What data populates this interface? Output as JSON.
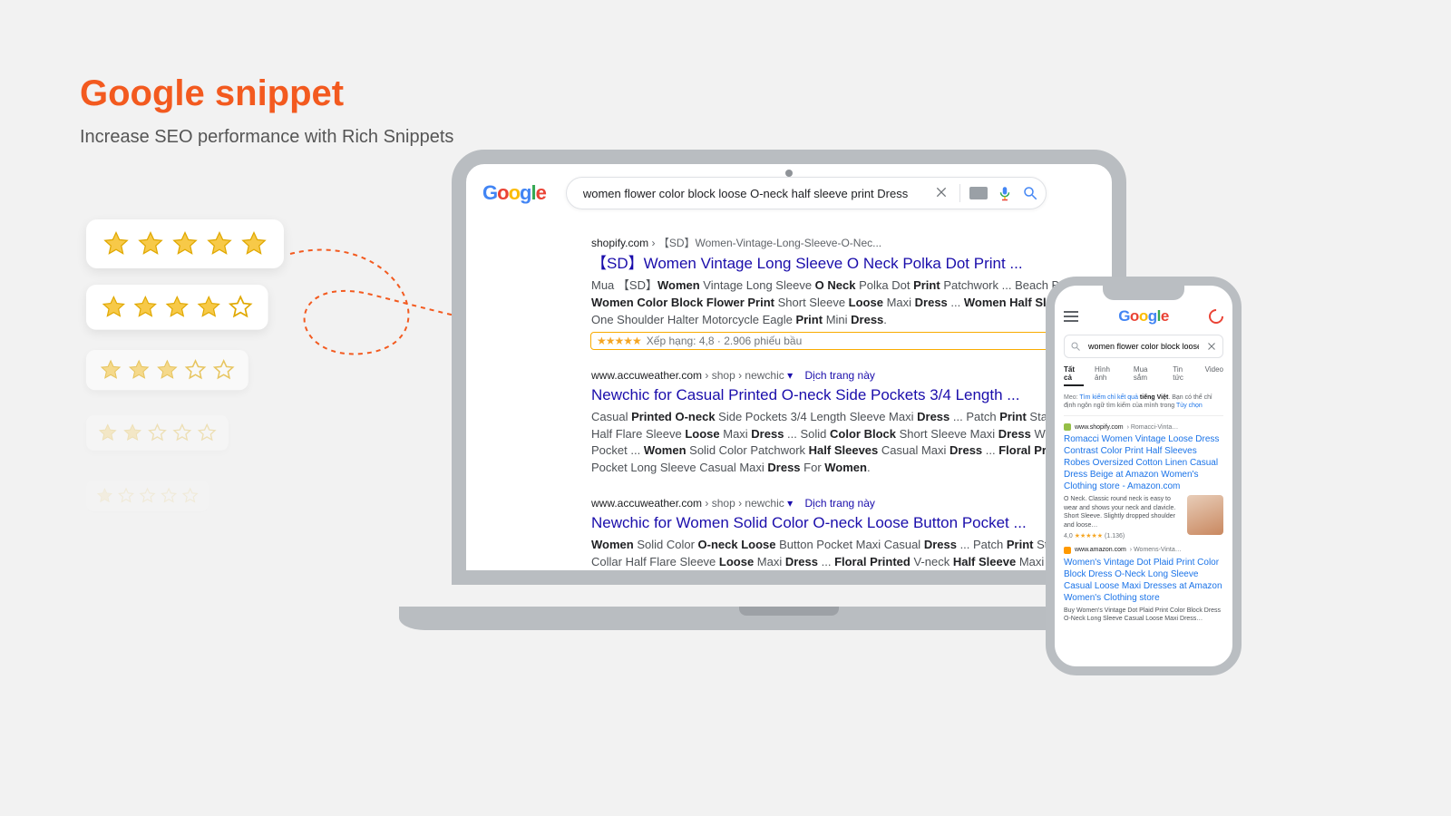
{
  "heading": {
    "title": "Google snippet",
    "subtitle": "Increase SEO performance with Rich Snippets"
  },
  "google_logo_letters": [
    "G",
    "o",
    "o",
    "g",
    "l",
    "e"
  ],
  "laptop": {
    "search_query": "women flower color block loose O-neck half sleeve print Dress",
    "results": [
      {
        "url_domain": "shopify.com",
        "url_path": "› 【SD】Women-Vintage-Long-Sleeve-O-Nec...",
        "title": "【SD】Women Vintage Long Sleeve O Neck Polka Dot Print ...",
        "desc_html": "Mua 【SD】<b>Women</b> Vintage Long Sleeve <b>O Neck</b> Polka Dot <b>Print</b> Patchwork ... Beach Boho <b>Women Color Block Flower Print</b> Short Sleeve <b>Loose</b> Maxi <b>Dress</b> ... <b>Women Half Sleeve</b> One Shoulder Halter Motorcycle Eagle <b>Print</b> Mini <b>Dress</b>.",
        "rating_text": "Xếp hạng: 4,8 · 2.906 phiếu bầu"
      },
      {
        "url_domain": "www.accuweather.com",
        "url_path": "› shop › newchic",
        "translate": "Dịch trang này",
        "title": "Newchic for Casual Printed O-neck Side Pockets 3/4 Length ...",
        "desc_html": "Casual <b>Printed O-neck</b> Side Pockets 3/4 Length Sleeve Maxi <b>Dress</b> ... Patch <b>Print</b> Stand Collar Half Flare Sleeve <b>Loose</b> Maxi <b>Dress</b> ... Solid <b>Color Block</b> Short Sleeve Maxi <b>Dress</b> With Pocket ... <b>Women</b> Solid Color Patchwork <b>Half Sleeves</b> Casual Maxi <b>Dress</b> ... <b>Floral Print</b> Pocket Long Sleeve Casual Maxi <b>Dress</b> For <b>Women</b>."
      },
      {
        "url_domain": "www.accuweather.com",
        "url_path": "› shop › newchic",
        "translate": "Dịch trang này",
        "title": "Newchic for Women Solid Color O-neck Loose Button Pocket ...",
        "desc_html": "<b>Women</b> Solid Color <b>O-neck Loose</b> Button Pocket Maxi Casual <b>Dress</b> ... Patch <b>Print</b> Stand Collar Half Flare Sleeve <b>Loose</b> Maxi <b>Dress</b> ... <b>Floral Printed</b> V-neck <b>Half Sleeve</b> Maxi <b>Dress</b> ... Solid <b>Color Block</b> Short Sleeve Maxi <b>Dress</b> With Pocket."
      }
    ]
  },
  "phone": {
    "search_query": "women flower color block loose O-",
    "tabs": [
      "Tất cả",
      "Hình ảnh",
      "Mua sắm",
      "Tin tức",
      "Video"
    ],
    "tip_label": "Meo:",
    "tip_text_1": "Tìm kiếm chỉ kết quả",
    "tip_bold": "tiếng Việt",
    "tip_text_2": ". Bạn có thể chỉ định ngôn ngữ tìm kiếm của mình trong",
    "tip_link": "Tùy chọn",
    "results": [
      {
        "fav": "shopify",
        "domain": "www.shopify.com",
        "path": "› Romacci-Vinta…",
        "title": "Romacci Women Vintage Loose Dress Contrast Color Print Half Sleeves Robes Oversized Cotton Linen Casual Dress Beige at Amazon Women's Clothing store - Amazon.com",
        "desc": "O Neck. Classic round neck is easy to wear and shows your neck and clavicle. Short Sleeve. Slightly dropped shoulder and loose…",
        "rating_val": "4,0",
        "rating_count": "(1.136)",
        "thumb": true
      },
      {
        "fav": "amazon",
        "domain": "www.amazon.com",
        "path": "› Womens-Vinta…",
        "title": "Women's Vintage Dot Plaid Print Color Block Dress O-Neck Long Sleeve Casual Loose Maxi Dresses at Amazon Women's Clothing store",
        "desc": "Buy Women's Vintage Dot Plaid Print Color Block Dress O-Neck Long Sleeve Casual Loose Maxi Dress…"
      }
    ]
  }
}
